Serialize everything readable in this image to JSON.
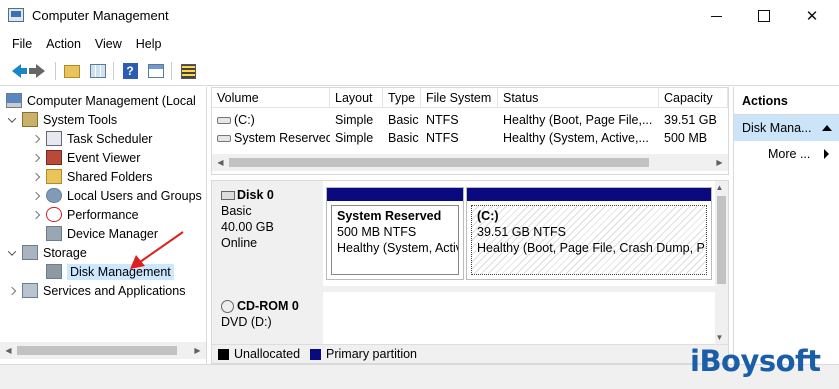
{
  "window": {
    "title": "Computer Management"
  },
  "menu": [
    "File",
    "Action",
    "View",
    "Help"
  ],
  "toolbar": {
    "icons": [
      "back-icon",
      "forward-icon",
      "up-folder-icon",
      "console-tree-icon",
      "help-icon",
      "show-panel-icon",
      "properties-icon"
    ]
  },
  "tree": {
    "root": "Computer Management (Local",
    "system_tools": "System Tools",
    "task_scheduler": "Task Scheduler",
    "event_viewer": "Event Viewer",
    "shared_folders": "Shared Folders",
    "local_users": "Local Users and Groups",
    "performance": "Performance",
    "device_manager": "Device Manager",
    "storage": "Storage",
    "disk_management": "Disk Management",
    "services": "Services and Applications"
  },
  "volumes": {
    "headers": [
      "Volume",
      "Layout",
      "Type",
      "File System",
      "Status",
      "Capacity"
    ],
    "rows": [
      [
        "(C:)",
        "Simple",
        "Basic",
        "NTFS",
        "Healthy (Boot, Page File,...",
        "39.51 GB"
      ],
      [
        "System Reserved",
        "Simple",
        "Basic",
        "NTFS",
        "Healthy (System, Active,...",
        "500 MB"
      ]
    ]
  },
  "disks": {
    "disk0": {
      "name": "Disk 0",
      "type": "Basic",
      "size": "40.00 GB",
      "status": "Online"
    },
    "partitions": [
      {
        "name": "System Reserved",
        "size": "500 MB NTFS",
        "status": "Healthy (System, Activ"
      },
      {
        "name": "(C:)",
        "size": "39.51 GB NTFS",
        "status": "Healthy (Boot, Page File, Crash Dump, P"
      }
    ],
    "cdrom": {
      "name": "CD-ROM 0",
      "drive": "DVD (D:)"
    }
  },
  "legend": {
    "unallocated": "Unallocated",
    "primary": "Primary partition"
  },
  "colors": {
    "primary_partition": "#0a0a80",
    "unallocated": "#000000",
    "selection": "#cce8ff",
    "annotation_arrow": "#e02020",
    "brand": "#1a5ea8"
  },
  "actions": {
    "title": "Actions",
    "selected": "Disk Mana...",
    "more": "More ..."
  },
  "watermark": "iBoysoft"
}
